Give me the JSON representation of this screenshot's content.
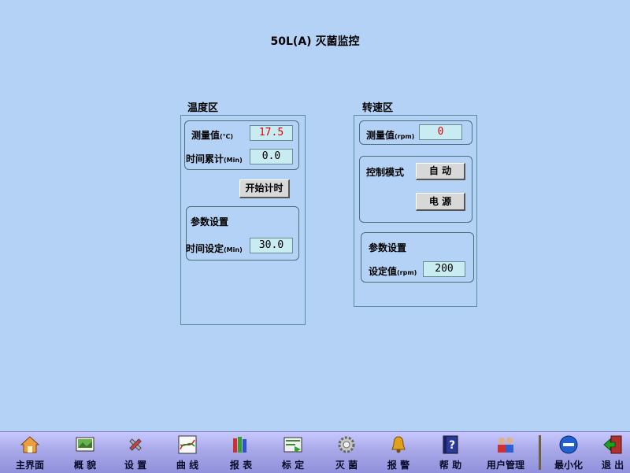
{
  "title": "50L(A)  灭菌监控",
  "temperature": {
    "section_title": "温度区",
    "measured_label": "测量值",
    "measured_unit": "(℃)",
    "measured_value": "17.5",
    "time_label": "时间累计",
    "time_unit": "(Min)",
    "time_value": "0.0",
    "start_button": "开始计时",
    "params_title": "参数设置",
    "set_time_label": "时间设定",
    "set_time_unit": "(Min)",
    "set_time_value": "30.0"
  },
  "speed": {
    "section_title": "转速区",
    "measured_label": "测量值",
    "measured_unit": "(rpm)",
    "measured_value": "0",
    "control_label": "控制模式",
    "auto_button": "自  动",
    "power_button": "电  源",
    "params_title": "参数设置",
    "setpoint_label": "设定值",
    "setpoint_unit": "(rpm)",
    "setpoint_value": "200"
  },
  "taskbar": [
    {
      "label": "主界面",
      "icon": "home-icon"
    },
    {
      "label": "概 貌",
      "icon": "overview-icon"
    },
    {
      "label": "设 置",
      "icon": "settings-tools-icon"
    },
    {
      "label": "曲 线",
      "icon": "curve-chart-icon"
    },
    {
      "label": "报 表",
      "icon": "report-books-icon"
    },
    {
      "label": "标 定",
      "icon": "calibrate-icon"
    },
    {
      "label": "灭 菌",
      "icon": "sterilize-gear-icon"
    },
    {
      "label": "报 警",
      "icon": "alarm-bell-icon"
    },
    {
      "label": "帮 助",
      "icon": "help-book-icon"
    },
    {
      "label": "用户管理",
      "icon": "users-icon"
    },
    {
      "label": "最小化",
      "icon": "minimize-icon"
    },
    {
      "label": "退 出",
      "icon": "exit-door-icon"
    }
  ],
  "colors": {
    "background": "#b4d2f5",
    "value_box": "#c8ecf2",
    "measured_temp_text": "#e00000",
    "measured_rpm_text": "#e00000",
    "taskbar": "#a8a8e8"
  }
}
